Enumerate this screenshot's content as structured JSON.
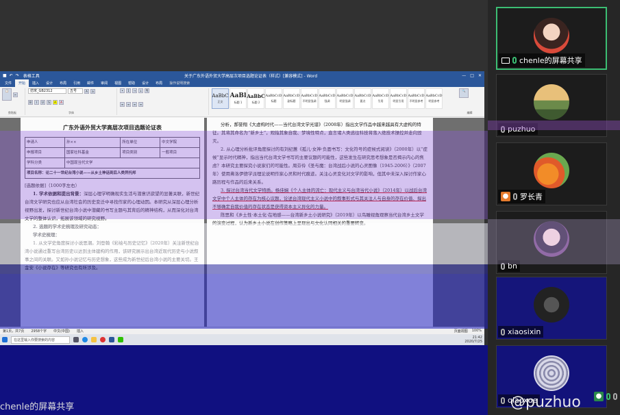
{
  "word": {
    "title": "关于广东外语外贸大学高层次项目选题论证表（样式）[兼容模式] - Word",
    "context_tab": "表格工具",
    "tabs": [
      "文件",
      "开始",
      "插入",
      "设计",
      "布局",
      "引用",
      "邮件",
      "审阅",
      "视图",
      "帮助",
      "设计",
      "布局"
    ],
    "search_tab": "操作说明搜索",
    "font_name": "仿宋_GB2312",
    "font_size": "五号",
    "group_clipboard": "剪贴板",
    "group_font": "字体",
    "group_styles": "样式",
    "group_edit": "编辑",
    "styles": [
      {
        "preview": "AaBbC",
        "name": "正文"
      },
      {
        "preview": "AaBl",
        "name": "标题 1"
      },
      {
        "preview": "AaBbC",
        "name": "标题 2"
      },
      {
        "preview": "AaBbCcD",
        "name": "标题"
      },
      {
        "preview": "AaBbCcD",
        "name": "副标题"
      },
      {
        "preview": "AaBbCcD",
        "name": "不明显强调"
      },
      {
        "preview": "AaBbCcD",
        "name": "强调"
      },
      {
        "preview": "AaBbCcD",
        "name": "明显强调"
      },
      {
        "preview": "AaBbCcD",
        "name": "要点"
      },
      {
        "preview": "AaBbCcD",
        "name": "引用"
      },
      {
        "preview": "AaBbCcD",
        "name": "明显引用"
      },
      {
        "preview": "AaBbCcD",
        "name": "不明显参考"
      },
      {
        "preview": "AaBbCcD",
        "name": "明显参考"
      }
    ],
    "page1": {
      "title": "广东外语外贸大学高层次项目选题论证表",
      "form_rows": [
        [
          "申请人",
          "孙××",
          "所在单位",
          "中文学院"
        ],
        [
          "申报项目",
          "国家社科基金",
          "项目类别",
          "一般项目"
        ],
        [
          "学科分类",
          "中国现当代文学",
          "",
          ""
        ]
      ],
      "project_name": "项目名称：论二十一世纪台湾小说——从乡土神话到后人类异托邦",
      "basis": "[选题依据]（1000字左右）",
      "p1_head": "1. 学术依据和提出背景：",
      "p1": "深层心理学明确现实生活与潜意识欲望的显著关联，新世纪台湾文学研究也应从台湾社会的历史变迁中寻找作家的心理动因。本研究从深层心理分析视野出发，探讨新世纪台湾小说中潜藏的书写主题与其背后的精神结构，从而深化对台湾文学的整体认识，拓展该领域的研究视野。",
      "p2_head": "2. 选题的学术史梳理及研究动态：",
      "p3_head": "学术史梳理：",
      "p3": "1. 从文学史角度探讨小说思潮。刘登翰《彩绘与历史记忆》（2020年）关注新世纪台湾小说通过重写台湾历史以达到主体建构的作用，该研究展示出台湾近现代历史与小说叙事之间的关联。又如孙小说记忆与历史想象，这些成为新世纪后台湾小说的主要关切。王金安《小说存在》等研究也有所涉及。"
    },
    "page2": {
      "p1": "分析，郝誉翔《大虚构时代——当代台湾文学光谱》（2008年）指出文学作品中越来越具有大虚构的特征。其将其命名为“新乡土”，观指其象自我、梦境性特点，直言诸人类逃往科技将落入绝技术操控并走向毁灭。",
      "p2": "2. 从心理分析批评角度探讨的有刘纪蕙《孤儿·女神·负面书写：文化符号的症候式阅读》（2000年）以“症候”显示时代精神，指出当代台湾文学书写的主要议题的可能性，这些发生在研究思考想象是否揭示内心的焦虑？本研究主要探究小说家们的可能性。周芬伶《圣与魔：台湾战后小说的心灵图像（1945-2006）》（2007年）使用弗洛伊德学派理论说明作家心灵和时代痕迹。关注心灵变化对文学的影响，但其中未深入探讨作家心路历程与作品的后来关系。",
      "p3": "3. 探讨台湾当代文学特质。杨佳娴《个人主体的流亡：现代主义与台湾当代小说》（2014年）以战后台湾文学中个人主体的存在为核心议题，论述台湾现代主义小说中的叙事形式与其关注人与自身的存在价值、探出不够确定自我价值的存在状态是获得资本主义异化的力量。",
      "p4": "陈思和《乡土性·本土化·在地感——台湾新乡土小说研究》（2019年）以鸟瞰视角观察当代台湾乡土文学的演变过程，认为新乡土小说在创作策略上呈现出与文化认同相关的重要转变。"
    },
    "status": {
      "page": "第1页，共7页",
      "words": "2958个字",
      "lang": "中文(中国)",
      "mode": "插入",
      "view": "页面视图",
      "zoom": "100%"
    },
    "taskbar": {
      "input_hint": "在这里输入你要搜索的内容",
      "time": "21:42",
      "date": "2020/7/25"
    }
  },
  "participants": [
    {
      "name": "chenle的屏幕共享",
      "active": true
    },
    {
      "name": "puzhuo",
      "active": false
    },
    {
      "name": "罗长青",
      "active": false
    },
    {
      "name": "bn",
      "active": false
    },
    {
      "name": "xiaosixin",
      "active": false
    },
    {
      "name": "qiaoxue",
      "active": false
    }
  ],
  "screen_label": "chenle的屏幕共享",
  "watermark": "@puzhuo"
}
